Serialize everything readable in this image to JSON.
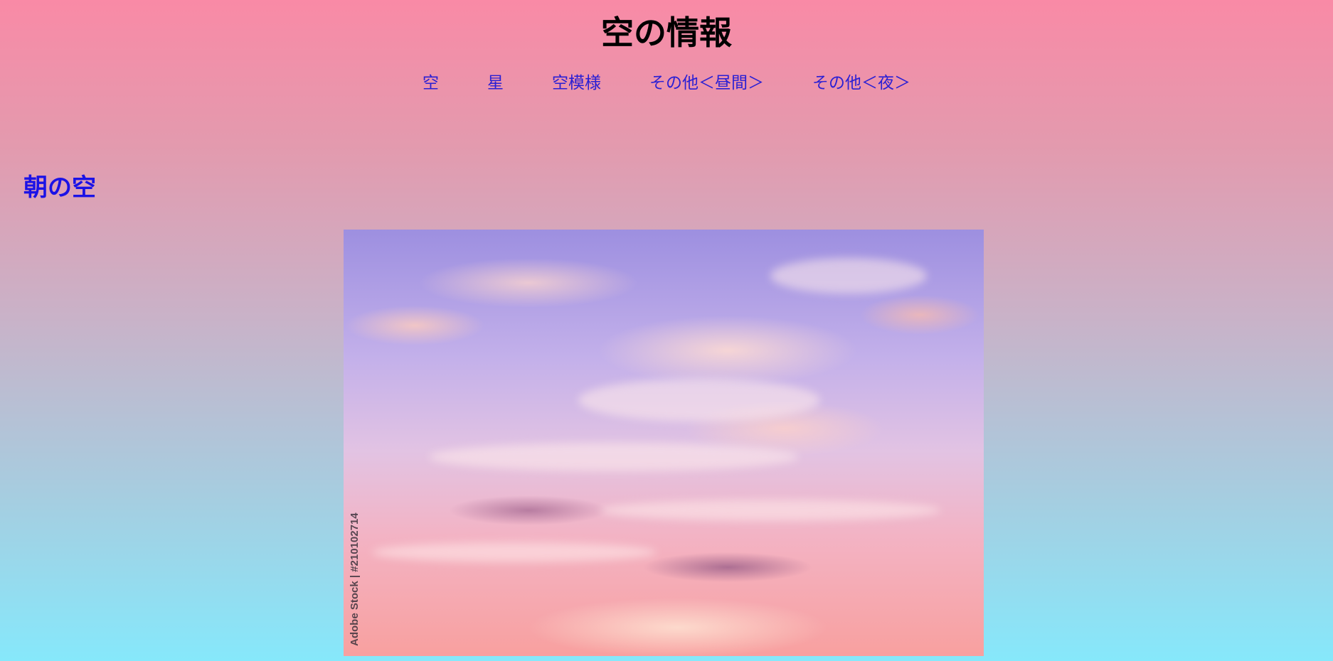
{
  "header": {
    "title": "空の情報"
  },
  "nav": {
    "items": [
      {
        "label": "空"
      },
      {
        "label": "星"
      },
      {
        "label": "空模様"
      },
      {
        "label": "その他＜昼間＞"
      },
      {
        "label": "その他＜夜＞"
      }
    ]
  },
  "main": {
    "section_title": "朝の空",
    "photo": {
      "watermark": "Adobe Stock | #210102714"
    }
  },
  "colors": {
    "background_top": "#f98aa6",
    "background_bottom": "#86e8fb",
    "nav_link": "#2a1fd4",
    "section_title": "#1b12e6"
  }
}
